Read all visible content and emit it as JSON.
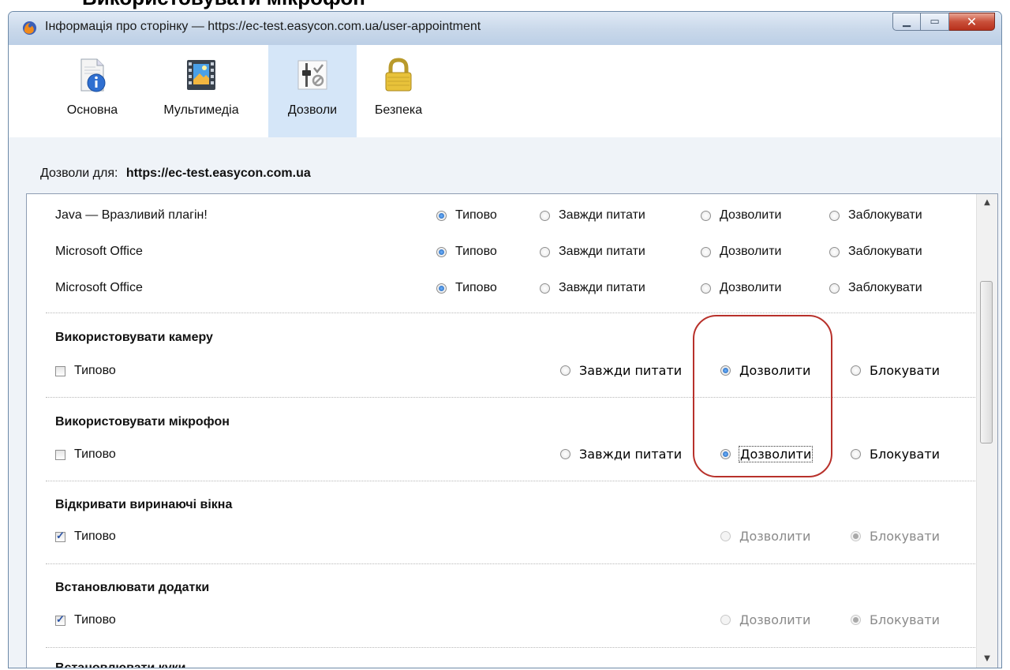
{
  "window": {
    "title": "Інформація про сторінку — https://ec-test.easycon.com.ua/user-appointment",
    "above_text": "Використовувати мікрофон"
  },
  "toolbar": {
    "tabs": [
      {
        "label": "Основна",
        "icon": "info-page-icon"
      },
      {
        "label": "Мультимедіа",
        "icon": "media-film-icon"
      },
      {
        "label": "Дозволи",
        "icon": "permissions-icon",
        "active": true
      },
      {
        "label": "Безпека",
        "icon": "lock-icon"
      }
    ]
  },
  "permissions": {
    "label": "Дозволи для:",
    "site": "https://ec-test.easycon.com.ua"
  },
  "plugins": [
    {
      "name": "Java — Вразливий плагін!",
      "options": [
        "Типово",
        "Завжди питати",
        "Дозволити",
        "Заблокувати"
      ],
      "selected": "Типово"
    },
    {
      "name": "Microsoft Office",
      "options": [
        "Типово",
        "Завжди питати",
        "Дозволити",
        "Заблокувати"
      ],
      "selected": "Типово"
    },
    {
      "name": "Microsoft Office",
      "options": [
        "Типово",
        "Завжди питати",
        "Дозволити",
        "Заблокувати"
      ],
      "selected": "Типово"
    }
  ],
  "sections": [
    {
      "title": "Використовувати камеру",
      "default_label": "Типово",
      "default_checked": false,
      "options": [
        "Завжди питати",
        "Дозволити",
        "Блокувати"
      ],
      "selected": "Дозволити"
    },
    {
      "title": "Використовувати мікрофон",
      "default_label": "Типово",
      "default_checked": false,
      "options": [
        "Завжди питати",
        "Дозволити",
        "Блокувати"
      ],
      "selected": "Дозволити"
    },
    {
      "title": "Відкривати виринаючі вікна",
      "default_label": "Типово",
      "default_checked": true,
      "options": [
        "Дозволити",
        "Блокувати"
      ],
      "selected": "Блокувати"
    },
    {
      "title": "Встановлювати додатки",
      "default_label": "Типово",
      "default_checked": true,
      "options": [
        "Дозволити",
        "Блокувати"
      ],
      "selected": "Блокувати"
    },
    {
      "title": "Встановлювати куки"
    }
  ],
  "colors": {
    "highlight": "#b8312b",
    "active_tab": "#d5e6f8"
  }
}
